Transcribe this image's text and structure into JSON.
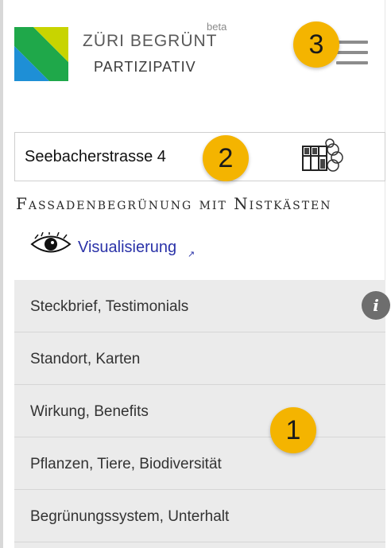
{
  "header": {
    "brand_title": "ZÜRI BEGRÜNT",
    "brand_subtitle": "PARTIZIPATIV",
    "beta_label": "beta"
  },
  "address": {
    "value": "Seebacherstrasse 4"
  },
  "project": {
    "title": "Fassadenbegrünung mit Nistkästen",
    "visualization_link": "Visualisierung",
    "external_icon": "↗"
  },
  "accordion": {
    "items": [
      {
        "label": "Steckbrief, Testimonials"
      },
      {
        "label": "Standort, Karten"
      },
      {
        "label": "Wirkung, Benefits"
      },
      {
        "label": "Pflanzen, Tiere, Biodiversität"
      },
      {
        "label": "Begrünungssystem, Unterhalt"
      }
    ],
    "info_icon": "i"
  },
  "annotations": {
    "badge1": "1",
    "badge2": "2",
    "badge3": "3"
  },
  "colors": {
    "badge": "#f4b400",
    "link": "#2a32a8",
    "accordion_bg": "#ebebeb"
  },
  "icons": [
    "logo-icon",
    "hamburger-menu-icon",
    "building-icon",
    "eye-icon",
    "external-link-icon",
    "info-icon"
  ]
}
